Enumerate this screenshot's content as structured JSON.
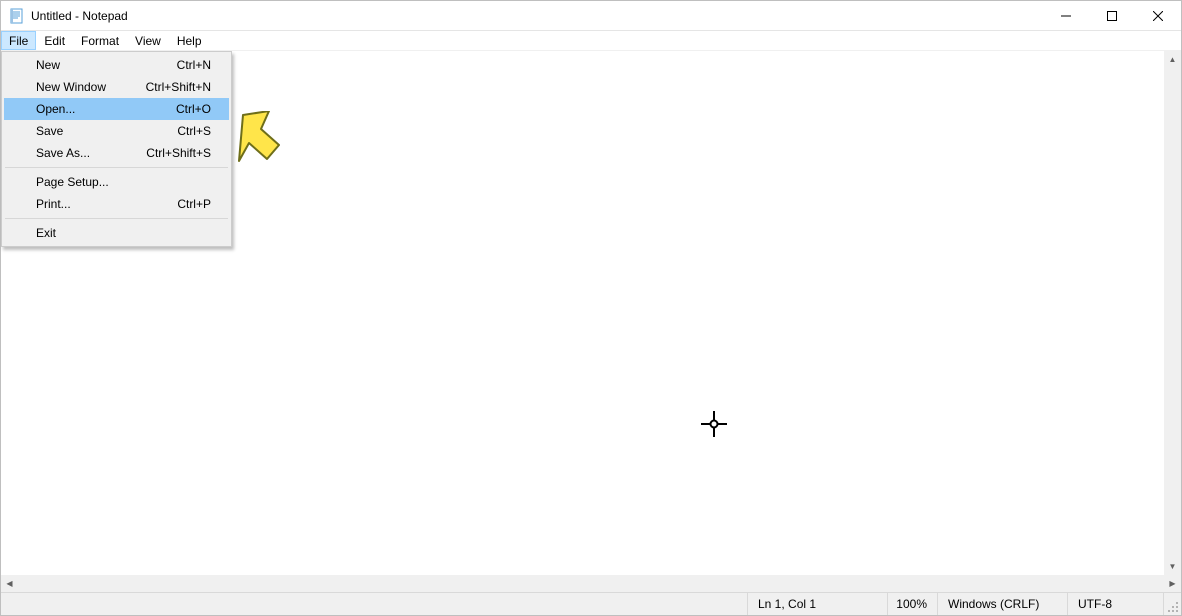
{
  "window": {
    "title": "Untitled - Notepad"
  },
  "menubar": {
    "items": [
      {
        "label": "File"
      },
      {
        "label": "Edit"
      },
      {
        "label": "Format"
      },
      {
        "label": "View"
      },
      {
        "label": "Help"
      }
    ]
  },
  "fileMenu": {
    "items": [
      {
        "label": "New",
        "shortcut": "Ctrl+N"
      },
      {
        "label": "New Window",
        "shortcut": "Ctrl+Shift+N"
      },
      {
        "label": "Open...",
        "shortcut": "Ctrl+O",
        "highlighted": true
      },
      {
        "label": "Save",
        "shortcut": "Ctrl+S"
      },
      {
        "label": "Save As...",
        "shortcut": "Ctrl+Shift+S"
      },
      {
        "separator": true
      },
      {
        "label": "Page Setup...",
        "shortcut": ""
      },
      {
        "label": "Print...",
        "shortcut": "Ctrl+P"
      },
      {
        "separator": true
      },
      {
        "label": "Exit",
        "shortcut": ""
      }
    ]
  },
  "status": {
    "position": "Ln 1, Col 1",
    "zoom": "100%",
    "lineEnding": "Windows (CRLF)",
    "encoding": "UTF-8"
  }
}
